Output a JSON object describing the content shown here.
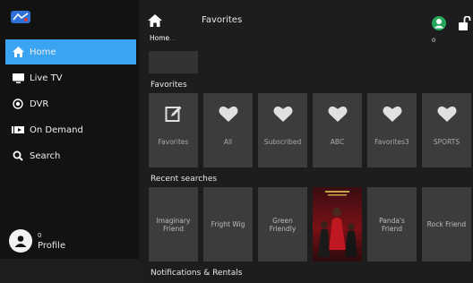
{
  "sidebar": {
    "items": [
      {
        "label": "Home"
      },
      {
        "label": "Live TV"
      },
      {
        "label": "DVR"
      },
      {
        "label": "On Demand"
      },
      {
        "label": "Search"
      }
    ],
    "profile": {
      "count": "0",
      "label": "Profile"
    }
  },
  "header": {
    "title": "Favorites",
    "breadcrumb": "Home",
    "user_count": "0"
  },
  "favorites": {
    "title": "Favorites",
    "tiles": [
      {
        "label": "Favorites",
        "icon": "edit-icon"
      },
      {
        "label": "All",
        "icon": "heart-icon"
      },
      {
        "label": "Subscribed",
        "icon": "heart-icon"
      },
      {
        "label": "ABC",
        "icon": "heart-icon"
      },
      {
        "label": "Favorites3",
        "icon": "heart-icon"
      },
      {
        "label": "SPORTS",
        "icon": "heart-icon"
      }
    ]
  },
  "recent_searches": {
    "title": "Recent searches",
    "tiles": [
      {
        "label": "Imaginary Friend"
      },
      {
        "label": "Fright Wig"
      },
      {
        "label": "Green Friendly"
      },
      {
        "label": ""
      },
      {
        "label": "Panda's Friend"
      },
      {
        "label": "Rock Friend"
      }
    ]
  },
  "notifications": {
    "title": "Notifications & Rentals"
  },
  "colors": {
    "accent": "#3aa3f2",
    "tile": "#3c3c3c",
    "background": "#1d1d1d"
  }
}
